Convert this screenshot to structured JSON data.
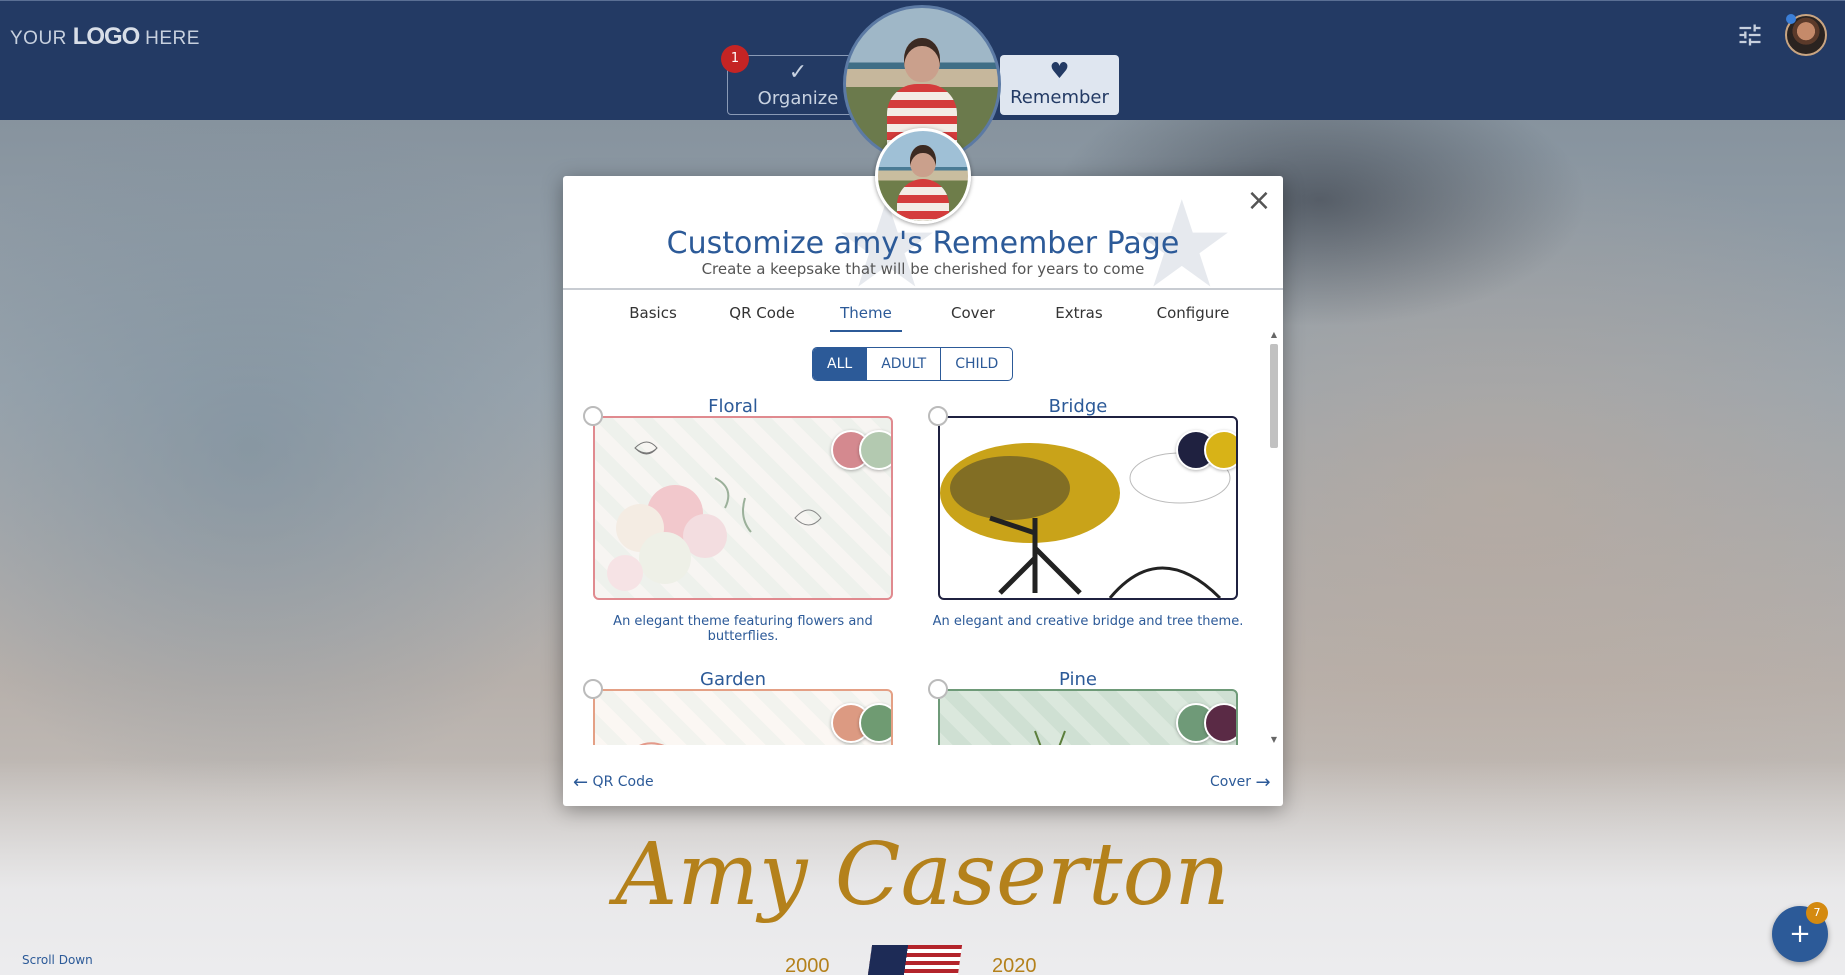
{
  "header": {
    "logo": {
      "prefix": "YOUR",
      "mark": "LOGO",
      "suffix": "HERE"
    },
    "icons": [
      "tune-icon",
      "user-avatar"
    ]
  },
  "steps": [
    {
      "label": "Organize",
      "badge": "1",
      "icon": "check-icon"
    },
    {
      "label": "Remember",
      "icon": "heart-icon"
    }
  ],
  "modal": {
    "title": "Customize amy's Remember Page",
    "subtitle": "Create a keepsake that will be cherished for years to come",
    "tabs": [
      "Basics",
      "QR Code",
      "Theme",
      "Cover",
      "Extras",
      "Configure"
    ],
    "active_tab": "Theme",
    "filters": [
      "ALL",
      "ADULT",
      "CHILD"
    ],
    "active_filter": "ALL",
    "themes": [
      {
        "name": "Floral",
        "description": "An elegant theme featuring flowers and butterflies.",
        "colors": [
          "#d4898f",
          "#b3c9b0"
        ]
      },
      {
        "name": "Bridge",
        "description": "An elegant and creative bridge and tree theme.",
        "colors": [
          "#1f2140",
          "#d8b317"
        ]
      },
      {
        "name": "Garden",
        "description": "",
        "colors": [
          "#dc9a82",
          "#6f9b72"
        ]
      },
      {
        "name": "Pine",
        "description": "",
        "colors": [
          "#6f9a78",
          "#5a2a45"
        ]
      }
    ],
    "nav": {
      "prev": "QR Code",
      "next": "Cover"
    }
  },
  "memorial": {
    "name": "Amy Caserton",
    "year_start": "2000",
    "year_end": "2020"
  },
  "scroll_hint": "Scroll Down",
  "fab": {
    "badge": "7"
  }
}
